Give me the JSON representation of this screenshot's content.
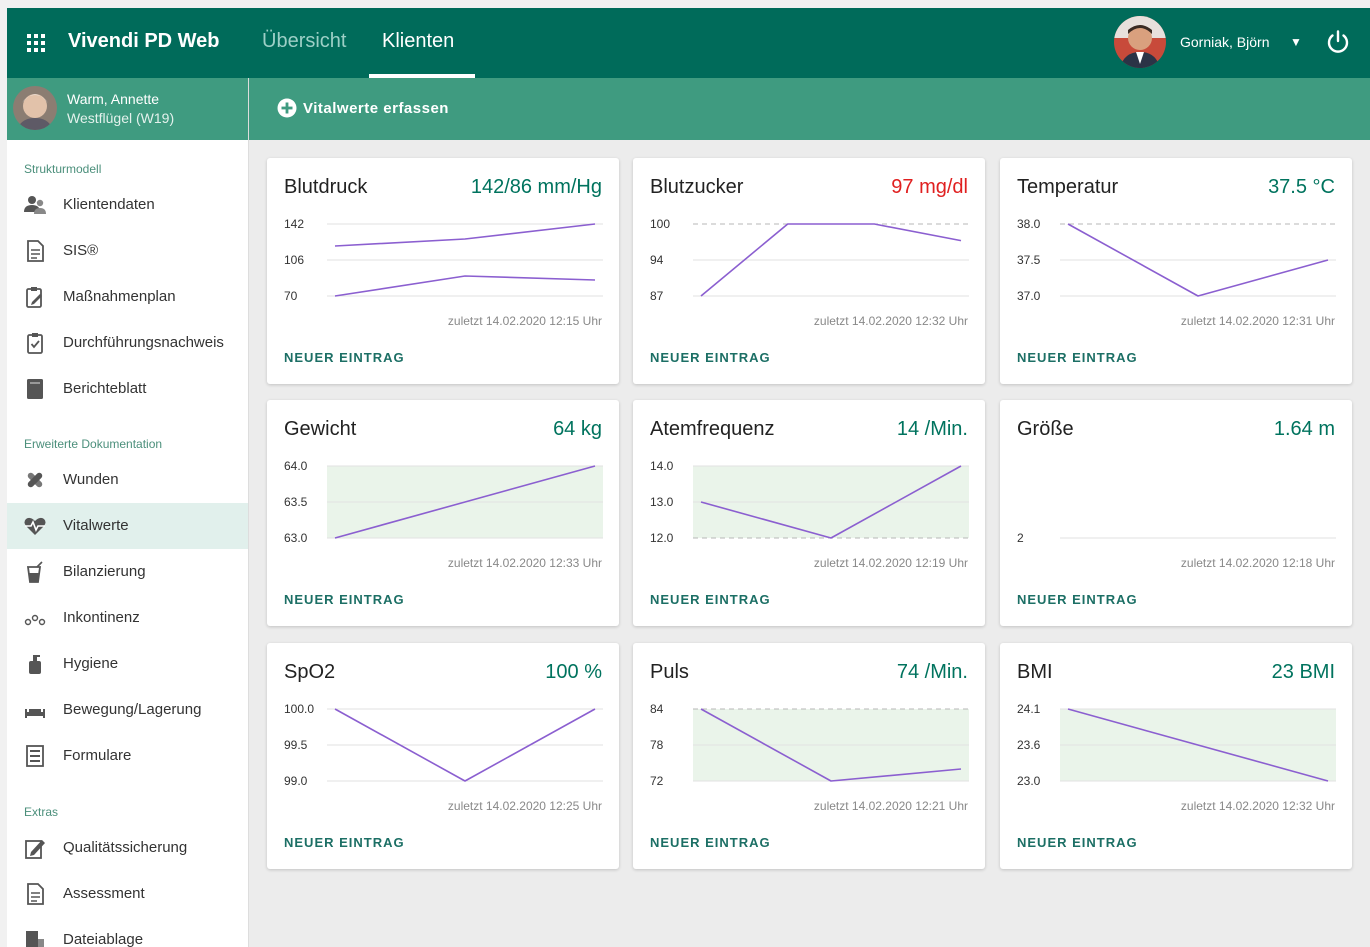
{
  "app": {
    "title": "Vivendi PD Web"
  },
  "nav": {
    "tabs": [
      {
        "label": "Übersicht"
      },
      {
        "label": "Klienten"
      }
    ]
  },
  "user": {
    "name": "Gorniak, Björn"
  },
  "client": {
    "name": "Warm, Annette",
    "ward": "Westflügel (W19)"
  },
  "sidebar": {
    "sections": [
      {
        "label": "Strukturmodell"
      },
      {
        "label": "Erweiterte Dokumentation"
      },
      {
        "label": "Extras"
      }
    ],
    "items": [
      {
        "label": "Klientendaten"
      },
      {
        "label": "SIS®"
      },
      {
        "label": "Maßnahmenplan"
      },
      {
        "label": "Durchführungsnachweis"
      },
      {
        "label": "Berichteblatt"
      },
      {
        "label": "Wunden"
      },
      {
        "label": "Vitalwerte"
      },
      {
        "label": "Bilanzierung"
      },
      {
        "label": "Inkontinenz"
      },
      {
        "label": "Hygiene"
      },
      {
        "label": "Bewegung/Lagerung"
      },
      {
        "label": "Formulare"
      },
      {
        "label": "Qualitätssicherung"
      },
      {
        "label": "Assessment"
      },
      {
        "label": "Dateiablage"
      }
    ]
  },
  "actionbar": {
    "add_label": "Vitalwerte erfassen"
  },
  "colors": {
    "primary": "#006b5a",
    "secondary": "#3f9b80",
    "accent_value": "#00735e",
    "alert": "#e02020",
    "line": "#8b5fd0",
    "band": "#eaf4ea"
  },
  "cards": [
    {
      "title": "Blutdruck",
      "value": "142/86 mm/Hg",
      "alert": false,
      "meta": "zuletzt 14.02.2020 12:15 Uhr",
      "action": "NEUER EINTRAG",
      "chart": {
        "ticks": [
          "142",
          "106",
          "70"
        ],
        "ylim": [
          70,
          142
        ],
        "band": null,
        "dashed": [],
        "series": [
          {
            "values": [
              120,
              127,
              142
            ]
          },
          {
            "values": [
              70,
              90,
              86
            ]
          }
        ]
      }
    },
    {
      "title": "Blutzucker",
      "value": "97 mg/dl",
      "alert": true,
      "meta": "zuletzt 14.02.2020 12:32 Uhr",
      "action": "NEUER EINTRAG",
      "chart": {
        "ticks": [
          "100",
          "94",
          "87"
        ],
        "ylim": [
          87,
          100
        ],
        "band": null,
        "dashed": [
          100
        ],
        "series": [
          {
            "values": [
              87,
              100,
              100,
              97
            ]
          }
        ]
      }
    },
    {
      "title": "Temperatur",
      "value": "37.5 °C",
      "alert": false,
      "meta": "zuletzt 14.02.2020 12:31 Uhr",
      "action": "NEUER EINTRAG",
      "chart": {
        "ticks": [
          "38.0",
          "37.5",
          "37.0"
        ],
        "ylim": [
          37.0,
          38.0
        ],
        "band": null,
        "dashed": [
          38.0
        ],
        "series": [
          {
            "values": [
              38.0,
              37.0,
              37.5
            ]
          }
        ]
      }
    },
    {
      "title": "Gewicht",
      "value": "64 kg",
      "alert": false,
      "meta": "zuletzt 14.02.2020 12:33 Uhr",
      "action": "NEUER EINTRAG",
      "chart": {
        "ticks": [
          "64.0",
          "63.5",
          "63.0"
        ],
        "ylim": [
          63.0,
          64.0
        ],
        "band": [
          63.0,
          64.0
        ],
        "dashed": [],
        "series": [
          {
            "values": [
              63.0,
              63.5,
              64.0
            ]
          }
        ]
      }
    },
    {
      "title": "Atemfrequenz",
      "value": "14 /Min.",
      "alert": false,
      "meta": "zuletzt 14.02.2020 12:19 Uhr",
      "action": "NEUER EINTRAG",
      "chart": {
        "ticks": [
          "14.0",
          "13.0",
          "12.0"
        ],
        "ylim": [
          12.0,
          14.0
        ],
        "band": [
          12.0,
          14.0
        ],
        "dashed": [
          12.0
        ],
        "series": [
          {
            "values": [
              13.0,
              12.0,
              14.0
            ]
          }
        ]
      }
    },
    {
      "title": "Größe",
      "value": "1.64 m",
      "alert": false,
      "meta": "zuletzt 14.02.2020 12:18 Uhr",
      "action": "NEUER EINTRAG",
      "chart": {
        "ticks": [
          "2"
        ],
        "ylim": [
          0,
          2
        ],
        "band": null,
        "dashed": [],
        "series": []
      }
    },
    {
      "title": "SpO2",
      "value": "100 %",
      "alert": false,
      "meta": "zuletzt 14.02.2020 12:25 Uhr",
      "action": "NEUER EINTRAG",
      "chart": {
        "ticks": [
          "100.0",
          "99.5",
          "99.0"
        ],
        "ylim": [
          99.0,
          100.0
        ],
        "band": null,
        "dashed": [],
        "series": [
          {
            "values": [
              100.0,
              99.0,
              100.0
            ]
          }
        ]
      }
    },
    {
      "title": "Puls",
      "value": "74 /Min.",
      "alert": false,
      "meta": "zuletzt 14.02.2020 12:21 Uhr",
      "action": "NEUER EINTRAG",
      "chart": {
        "ticks": [
          "84",
          "78",
          "72"
        ],
        "ylim": [
          72,
          84
        ],
        "band": [
          72,
          84
        ],
        "dashed": [
          84
        ],
        "series": [
          {
            "values": [
              84,
              72,
              74
            ]
          }
        ]
      }
    },
    {
      "title": "BMI",
      "value": "23 BMI",
      "alert": false,
      "meta": "zuletzt 14.02.2020 12:32 Uhr",
      "action": "NEUER EINTRAG",
      "chart": {
        "ticks": [
          "24.1",
          "23.6",
          "23.0"
        ],
        "ylim": [
          23.0,
          24.1
        ],
        "band": [
          23.0,
          24.1
        ],
        "dashed": [],
        "series": [
          {
            "values": [
              24.1,
              23.0
            ]
          }
        ]
      }
    }
  ]
}
